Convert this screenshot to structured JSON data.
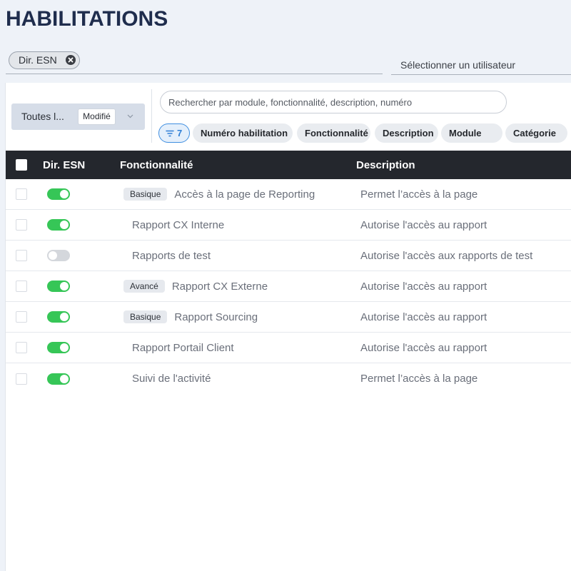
{
  "page": {
    "title": "HABILITATIONS"
  },
  "user_filter": {
    "selected_chip": "Dir. ESN",
    "user_select_placeholder": "Sélectionner un utilisateur"
  },
  "toolbar": {
    "status_select": {
      "value": "Toutes l...",
      "badge": "Modifié"
    },
    "search_placeholder": "Rechercher par module, fonctionnalité, description, numéro",
    "active_filter_count": "7",
    "column_chips": [
      "Numéro habilitation",
      "Fonctionnalité",
      "Description",
      "Module",
      "Catégorie"
    ]
  },
  "table": {
    "headers": {
      "role": "Dir. ESN",
      "feature": "Fonctionnalité",
      "description": "Description"
    },
    "rows": [
      {
        "enabled": true,
        "level": "Basique",
        "feature": "Accès à la page de Reporting",
        "description": "Permet l’accès à la page"
      },
      {
        "enabled": true,
        "feature": "Rapport CX Interne",
        "description": "Autorise l'accès au rapport"
      },
      {
        "enabled": false,
        "feature": "Rapports de test",
        "description": "Autorise l'accès aux rapports de test"
      },
      {
        "enabled": true,
        "level": "Avancé",
        "feature": "Rapport CX Externe",
        "description": "Autorise l'accès au rapport"
      },
      {
        "enabled": true,
        "level": "Basique",
        "feature": "Rapport Sourcing",
        "description": "Autorise l'accès au rapport"
      },
      {
        "enabled": true,
        "feature": "Rapport Portail Client",
        "description": "Autorise l'accès au rapport"
      },
      {
        "enabled": true,
        "feature": "Suivi de l'activité",
        "description": "Permet l’accès à la page"
      }
    ]
  },
  "icons": {
    "remove_chip": "close-circle-icon",
    "select_chevron": "chevron-down-icon",
    "filter": "filter-icon"
  },
  "colors": {
    "title": "#1f2d4d",
    "toggle_on": "#36c657",
    "toggle_off": "#d4d7dc",
    "table_header": "#24272d",
    "filter_accent": "#3f8ee0"
  }
}
